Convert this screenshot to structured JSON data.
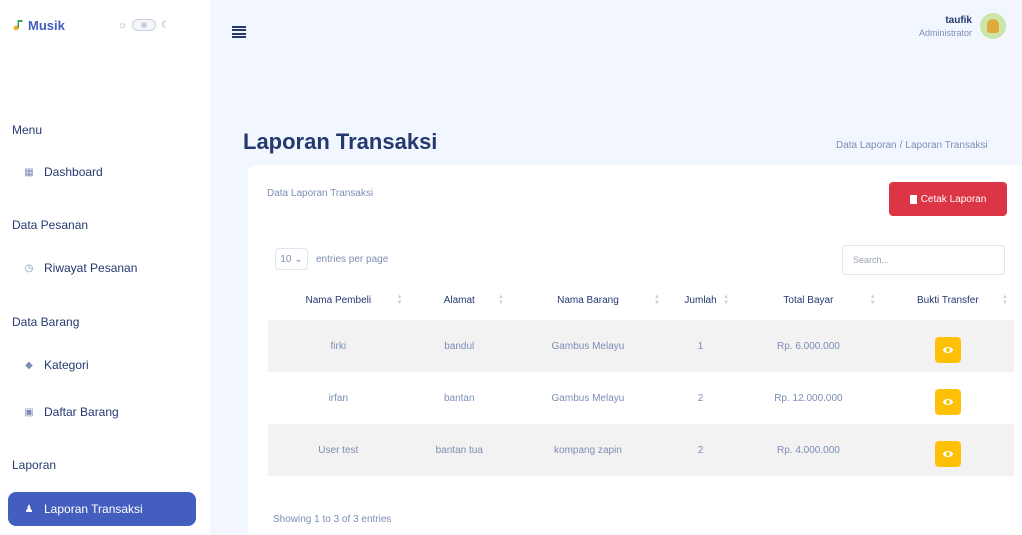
{
  "sidebar": {
    "brand": "Musik",
    "menu_title": "Menu",
    "items": [
      {
        "type": "item",
        "label": "Dashboard",
        "icon": "grid-icon"
      },
      {
        "type": "title",
        "label": "Data Pesanan"
      },
      {
        "type": "item",
        "label": "Riwayat Pesanan",
        "icon": "clock-icon"
      },
      {
        "type": "title",
        "label": "Data Barang"
      },
      {
        "type": "item",
        "label": "Kategori",
        "icon": "tag-icon"
      },
      {
        "type": "item",
        "label": "Daftar Barang",
        "icon": "calendar-icon"
      },
      {
        "type": "title",
        "label": "Laporan"
      },
      {
        "type": "item",
        "label": "Laporan Transaksi",
        "icon": "user-plus-icon",
        "active": true
      }
    ]
  },
  "header": {
    "user_name": "taufik",
    "user_role": "Administrator"
  },
  "page": {
    "title": "Laporan Transaksi",
    "breadcrumb": [
      "Data Laporan",
      "Laporan Transaksi"
    ]
  },
  "card": {
    "title": "Data Laporan Transaksi",
    "print_button": "Cetak Laporan",
    "entries_value": "10",
    "entries_label": "entries per page",
    "search_placeholder": "Search...",
    "columns": [
      "Nama Pembeli",
      "Alamat",
      "Nama Barang",
      "Jumlah",
      "Total Bayar",
      "Bukti Transfer"
    ],
    "rows": [
      [
        "firki",
        "bandul",
        "Gambus Melayu",
        "1",
        "Rp. 6.000.000"
      ],
      [
        "irfan",
        "bantan",
        "Gambus Melayu",
        "2",
        "Rp. 12.000.000"
      ],
      [
        "User test",
        "bantan tua",
        "kompang zapin",
        "2",
        "Rp. 4.000.000"
      ]
    ],
    "footer": "Showing 1 to 3 of 3 entries"
  },
  "colors": {
    "primary": "#435ebe",
    "danger": "#dc3545",
    "warning": "#ffc107",
    "background": "#f2f7ff"
  }
}
